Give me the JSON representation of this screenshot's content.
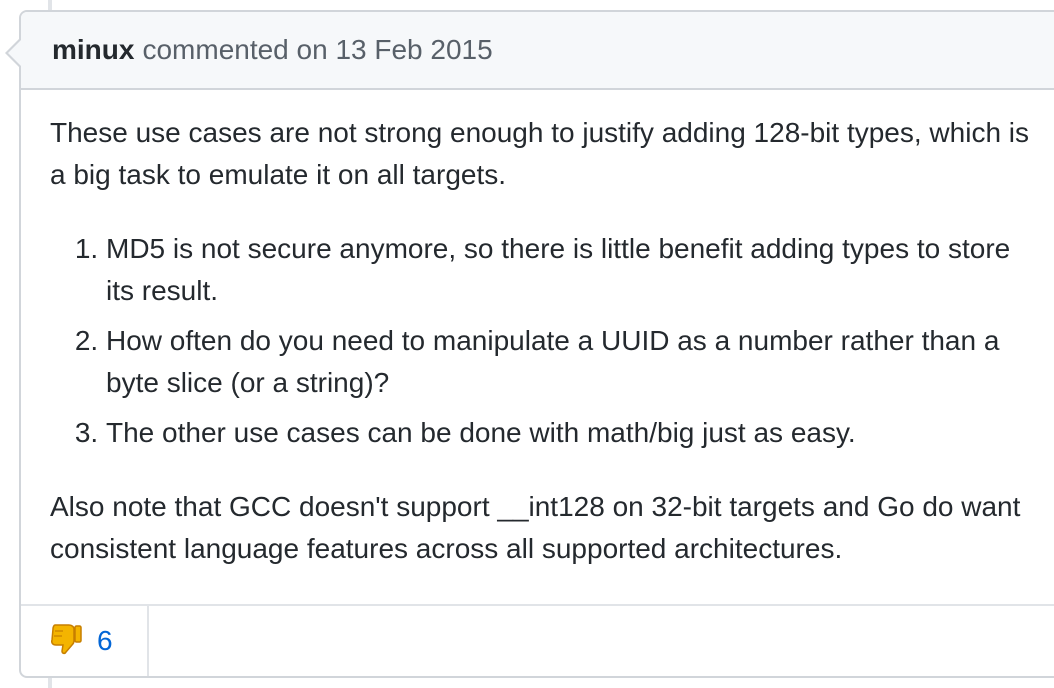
{
  "header": {
    "author": "minux",
    "action": "commented on 13 Feb 2015"
  },
  "body": {
    "paragraph1": "These use cases are not strong enough to justify adding 128-bit types, which is a big task to emulate it on all targets.",
    "list": [
      "MD5 is not secure anymore, so there is little benefit adding types to store its result.",
      "How often do you need to manipulate a UUID as a number rather than a byte slice (or a string)?",
      "The other use cases can be done with math/big just as easy."
    ],
    "paragraph2": "Also note that GCC doesn't support __int128 on 32-bit targets and Go do want consistent language features across all supported architectures."
  },
  "reactions": [
    {
      "icon": "thumbs-down-icon",
      "count": "6"
    }
  ],
  "colors": {
    "border": "#d1d5da",
    "header_bg": "#f6f8fa",
    "link": "#0366d6",
    "thumb": "#f4b400"
  }
}
